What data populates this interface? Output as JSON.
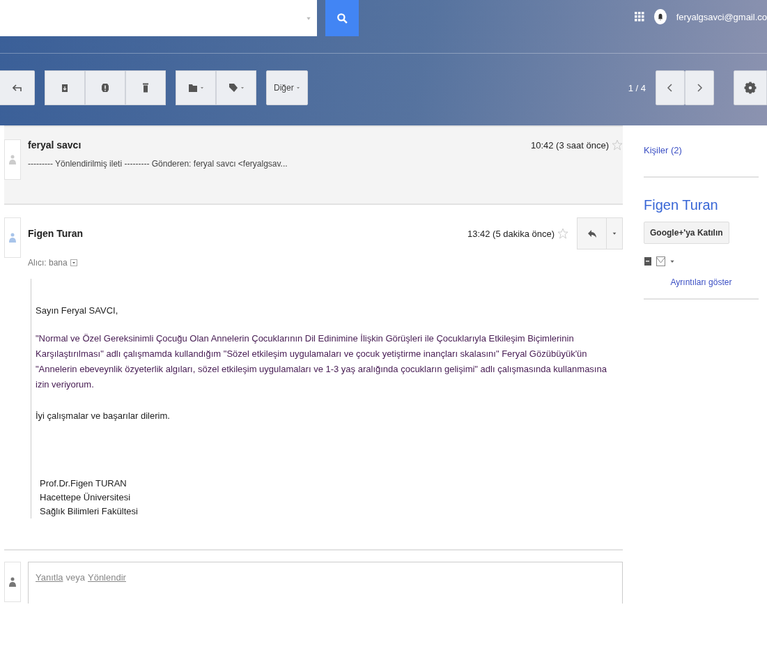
{
  "header": {
    "account": "feryalgsavci@gmail.co"
  },
  "toolbar": {
    "more_button": "Diğer",
    "pager": "1 / 4"
  },
  "messages": [
    {
      "kind": "collapsed",
      "sender": "feryal savcı",
      "time": "10:42 (3 saat önce)",
      "snippet": "--------- Yönlendirilmiş ileti --------- Gönderen: feryal savcı <feryalgsav...",
      "starred": false
    },
    {
      "kind": "expanded",
      "sender": "Figen Turan",
      "time": "13:42 (5 dakika önce)",
      "starred": false,
      "recipient": "Alıcı: bana",
      "greeting": "Sayın Feryal SAVCI,",
      "paragraph": "\"Normal ve Özel Gereksinimli Çocuğu Olan Annelerin Çocuklarının Dil Edinimine İlişkin Görüşleri ile Çocuklarıyla Etkileşim Biçimlerinin Karşılaştırılması\" adlı çalışmamda kullandığım \"Sözel etkileşim uygulamaları ve çocuk yetiştirme inançları skalasını\" Feryal Gözübüyük'ün \"Annelerin ebeveynlik özyeterlik algıları, sözel etkileşim uygulamaları ve 1-3 yaş aralığında çocukların gelişimi\" adlı çalışmasında kullanmasına izin veriyorum.",
      "closing": "İyi çalışmalar ve başarılar dilerim.",
      "signature": [
        "Prof.Dr.Figen TURAN",
        "Hacettepe Üniversitesi",
        "Sağlık Bilimleri Fakültesi"
      ]
    }
  ],
  "reply_box": {
    "reply_link": "Yanıtla",
    "separator": "veya",
    "forward_link": "Yönlendir"
  },
  "sidebar": {
    "people_link": "Kişiler (2)",
    "contact_name": "Figen Turan",
    "join_button": "Google+'ya Katılın",
    "details_link": "Ayrıntıları göster"
  }
}
